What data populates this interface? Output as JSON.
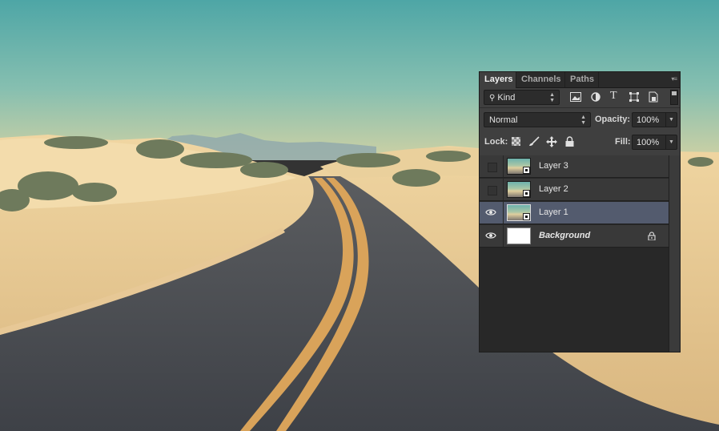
{
  "panel": {
    "tabs": [
      {
        "label": "Layers",
        "active": true
      },
      {
        "label": "Channels",
        "active": false
      },
      {
        "label": "Paths",
        "active": false
      }
    ],
    "filter": {
      "label": "Kind"
    },
    "blend_mode": "Normal",
    "opacity": {
      "label": "Opacity:",
      "value": "100%"
    },
    "lock": {
      "label": "Lock:"
    },
    "fill": {
      "label": "Fill:",
      "value": "100%"
    },
    "layers": [
      {
        "name": "Layer 3",
        "visible": false,
        "thumbnail": "photo",
        "smart_object": true,
        "selected": false
      },
      {
        "name": "Layer 2",
        "visible": false,
        "thumbnail": "photo",
        "smart_object": true,
        "selected": false
      },
      {
        "name": "Layer 1",
        "visible": true,
        "thumbnail": "photo",
        "smart_object": true,
        "selected": true
      },
      {
        "name": "Background",
        "visible": true,
        "thumbnail": "white",
        "locked": true,
        "selected": false
      }
    ]
  },
  "colors": {
    "sky": "#5fada8",
    "sand": "#e8cc98",
    "road": "#4a4d52",
    "road_line": "#d9a35a",
    "panel_bg": "#3f3f3f",
    "selection": "#535b6e"
  }
}
